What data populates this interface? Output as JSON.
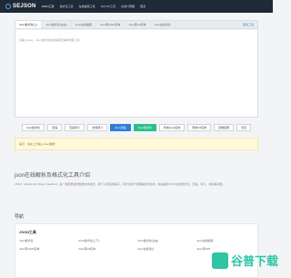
{
  "topbar": {
    "logo": "SEJSON",
    "nav": [
      "JSON工具",
      "格式化工具",
      "在线编码工具",
      "JS/CSS工具",
      "在线计算器",
      "更多"
    ]
  },
  "tabs": [
    "Json格式化(上)",
    "Json格式化(左右)",
    "Json在线编辑",
    "Json转JAVA实体",
    "Json转C#实体",
    "Json在线对比",
    "更多工具"
  ],
  "editor": {
    "placeholder": "请输入Json，Json格式化在线编辑及解析校验工具"
  },
  "toolbar": {
    "buttons": [
      "Json格式化",
      "压缩",
      "压缩转义",
      "去除转义",
      "Json压缩",
      "Json格式化",
      "转成Java实体",
      "转成C#实体",
      "复制结果",
      "清空"
    ]
  },
  "note": "提示：请在上方输入Json数据",
  "intro": {
    "title": "json在线解析及格式化工具介绍",
    "desc": "JSON（JavaScript Object Notation）是一种轻量级的数据交换格式，易于人阅读和编写，同时也易于机器解析和生成，本站提供JSON在线格式化、压缩、转义、校验等功能。"
  },
  "nav_heading": "导航",
  "nav_panel": {
    "group": "JSON工具",
    "items": [
      "Json格式化",
      "Json格式化(上下)",
      "Json格式化(左右)",
      "Json在线编辑",
      "Json转JAVA实体",
      "Json转C#实体",
      "Json在线对比",
      "Json转XML"
    ]
  },
  "watermark": "谷普下载"
}
